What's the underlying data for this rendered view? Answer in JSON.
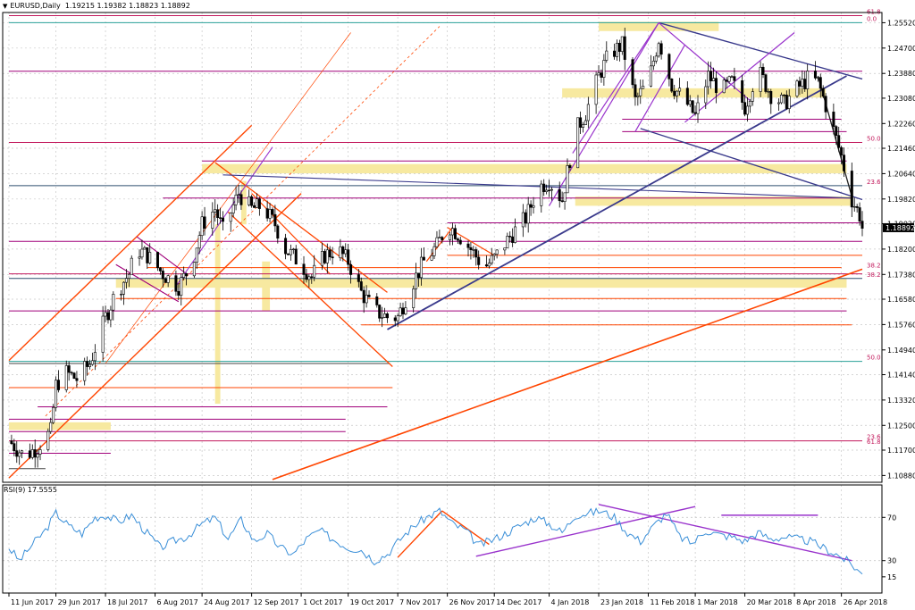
{
  "header": {
    "symbol_title": "EURUSD,Daily",
    "ohlc": "1.19215 1.19382 1.18823 1.18892"
  },
  "rsi": {
    "label": "RSI(9) 17.5555"
  },
  "colors": {
    "fib": "#c2185b",
    "support_orange": "#ff4500",
    "magenta": "#a0007a",
    "purple": "#9933cc",
    "navy": "#3a3a8c",
    "yellow_zone": "#f7e9a0",
    "rsi_line": "#3a8fd8",
    "candle": "#000000"
  },
  "chart_data": [
    {
      "type": "candlestick",
      "title": "EURUSD,Daily",
      "ylim": [
        1.1066,
        1.2585
      ],
      "price_labels": [
        "1.25520",
        "1.24700",
        "1.23880",
        "1.23080",
        "1.22260",
        "1.21460",
        "1.20640",
        "1.19820",
        "1.19020",
        "1.18200",
        "1.17380",
        "1.16580",
        "1.15760",
        "1.14940",
        "1.14140",
        "1.13320",
        "1.12500",
        "1.11700",
        "1.10880"
      ],
      "current_price_label": "1.18892",
      "date_labels": [
        "11 Jun 2017",
        "29 Jun 2017",
        "18 Jul 2017",
        "6 Aug 2017",
        "24 Aug 2017",
        "12 Sep 2017",
        "1 Oct 2017",
        "19 Oct 2017",
        "7 Nov 2017",
        "26 Nov 2017",
        "14 Dec 2017",
        "4 Jan 2018",
        "23 Jan 2018",
        "11 Feb 2018",
        "1 Mar 2018",
        "20 Mar 2018",
        "8 Apr 2018",
        "26 Apr 2018"
      ],
      "fib_labels": [
        {
          "text": "61.8",
          "price": 1.2575
        },
        {
          "text": "0.0",
          "price": 1.2552
        },
        {
          "text": "50.0",
          "price": 1.2165
        },
        {
          "text": "23.6",
          "price": 1.2025
        },
        {
          "text": "38.2",
          "price": 1.1755
        },
        {
          "text": "38.2",
          "price": 1.1725
        },
        {
          "text": "50.0",
          "price": 1.1457
        },
        {
          "text": "23.6",
          "price": 1.12
        },
        {
          "text": "61.8",
          "price": 1.1185
        }
      ],
      "path_anchors": [
        [
          "11 Jun 2017",
          1.12
        ],
        [
          "17 Jun 2017",
          1.115
        ],
        [
          "22 Jun 2017",
          1.118
        ],
        [
          "27 Jun 2017",
          1.123
        ],
        [
          "29 Jun 2017",
          1.138
        ],
        [
          "3 Jul 2017",
          1.142
        ],
        [
          "7 Jul 2017",
          1.14
        ],
        [
          "12 Jul 2017",
          1.145
        ],
        [
          "18 Jul 2017",
          1.16
        ],
        [
          "22 Jul 2017",
          1.168
        ],
        [
          "27 Jul 2017",
          1.174
        ],
        [
          "30 Jul 2017",
          1.182
        ],
        [
          "3 Aug 2017",
          1.18
        ],
        [
          "9 Aug 2017",
          1.174
        ],
        [
          "15 Aug 2017",
          1.17
        ],
        [
          "20 Aug 2017",
          1.177
        ],
        [
          "24 Aug 2017",
          1.19
        ],
        [
          "29 Aug 2017",
          1.195
        ],
        [
          "1 Sep 2017",
          1.188
        ],
        [
          "7 Sep 2017",
          1.2
        ],
        [
          "12 Sep 2017",
          1.195
        ],
        [
          "16 Sep 2017",
          1.196
        ],
        [
          "21 Sep 2017",
          1.19
        ],
        [
          "25 Sep 2017",
          1.182
        ],
        [
          "30 Sep 2017",
          1.178
        ],
        [
          "5 Oct 2017",
          1.173
        ],
        [
          "10 Oct 2017",
          1.18
        ],
        [
          "15 Oct 2017",
          1.182
        ],
        [
          "19 Oct 2017",
          1.178
        ],
        [
          "24 Oct 2017",
          1.168
        ],
        [
          "29 Oct 2017",
          1.162
        ],
        [
          "3 Nov 2017",
          1.16
        ],
        [
          "7 Nov 2017",
          1.16
        ],
        [
          "12 Nov 2017",
          1.17
        ],
        [
          "17 Nov 2017",
          1.178
        ],
        [
          "22 Nov 2017",
          1.183
        ],
        [
          "26 Nov 2017",
          1.19
        ],
        [
          "30 Nov 2017",
          1.187
        ],
        [
          "5 Dec 2017",
          1.182
        ],
        [
          "10 Dec 2017",
          1.176
        ],
        [
          "14 Dec 2017",
          1.179
        ],
        [
          "20 Dec 2017",
          1.186
        ],
        [
          "26 Dec 2017",
          1.192
        ],
        [
          "31 Dec 2017",
          1.202
        ],
        [
          "4 Jan 2018",
          1.204
        ],
        [
          "9 Jan 2018",
          1.198
        ],
        [
          "14 Jan 2018",
          1.22
        ],
        [
          "18 Jan 2018",
          1.226
        ],
        [
          "23 Jan 2018",
          1.238
        ],
        [
          "27 Jan 2018",
          1.245
        ],
        [
          "1 Feb 2018",
          1.248
        ],
        [
          "6 Feb 2018",
          1.23
        ],
        [
          "11 Feb 2018",
          1.236
        ],
        [
          "15 Feb 2018",
          1.25
        ],
        [
          "20 Feb 2018",
          1.235
        ],
        [
          "25 Feb 2018",
          1.23
        ],
        [
          "1 Mar 2018",
          1.225
        ],
        [
          "6 Mar 2018",
          1.238
        ],
        [
          "11 Mar 2018",
          1.233
        ],
        [
          "15 Mar 2018",
          1.236
        ],
        [
          "20 Mar 2018",
          1.228
        ],
        [
          "25 Mar 2018",
          1.24
        ],
        [
          "30 Mar 2018",
          1.232
        ],
        [
          "4 Apr 2018",
          1.229
        ],
        [
          "8 Apr 2018",
          1.233
        ],
        [
          "13 Apr 2018",
          1.237
        ],
        [
          "17 Apr 2018",
          1.236
        ],
        [
          "21 Apr 2018",
          1.226
        ],
        [
          "26 Apr 2018",
          1.212
        ],
        [
          "30 Apr 2018",
          1.198
        ],
        [
          "3 May 2018",
          1.193
        ],
        [
          "4 May 2018",
          1.1889
        ]
      ]
    },
    {
      "type": "line",
      "title": "RSI(9) 17.5555",
      "ylim": [
        0,
        100
      ],
      "y_tick_labels": [
        "70",
        "30",
        "15"
      ],
      "levels": [
        70,
        30
      ],
      "path_anchors": [
        [
          "11 Jun 2017",
          42
        ],
        [
          "15 Jun 2017",
          30
        ],
        [
          "20 Jun 2017",
          45
        ],
        [
          "25 Jun 2017",
          58
        ],
        [
          "29 Jun 2017",
          74
        ],
        [
          "4 Jul 2017",
          62
        ],
        [
          "9 Jul 2017",
          55
        ],
        [
          "14 Jul 2017",
          70
        ],
        [
          "18 Jul 2017",
          72
        ],
        [
          "23 Jul 2017",
          66
        ],
        [
          "28 Jul 2017",
          72
        ],
        [
          "2 Aug 2017",
          58
        ],
        [
          "8 Aug 2017",
          42
        ],
        [
          "13 Aug 2017",
          48
        ],
        [
          "18 Aug 2017",
          52
        ],
        [
          "24 Aug 2017",
          64
        ],
        [
          "29 Aug 2017",
          70
        ],
        [
          "3 Sep 2017",
          50
        ],
        [
          "8 Sep 2017",
          68
        ],
        [
          "13 Sep 2017",
          48
        ],
        [
          "18 Sep 2017",
          55
        ],
        [
          "23 Sep 2017",
          42
        ],
        [
          "28 Sep 2017",
          36
        ],
        [
          "3 Oct 2017",
          50
        ],
        [
          "8 Oct 2017",
          58
        ],
        [
          "13 Oct 2017",
          50
        ],
        [
          "19 Oct 2017",
          42
        ],
        [
          "24 Oct 2017",
          40
        ],
        [
          "29 Oct 2017",
          30
        ],
        [
          "3 Nov 2017",
          36
        ],
        [
          "8 Nov 2017",
          50
        ],
        [
          "13 Nov 2017",
          62
        ],
        [
          "18 Nov 2017",
          70
        ],
        [
          "23 Nov 2017",
          76
        ],
        [
          "28 Nov 2017",
          64
        ],
        [
          "3 Dec 2017",
          58
        ],
        [
          "8 Dec 2017",
          44
        ],
        [
          "14 Dec 2017",
          50
        ],
        [
          "19 Dec 2017",
          56
        ],
        [
          "25 Dec 2017",
          64
        ],
        [
          "30 Dec 2017",
          70
        ],
        [
          "4 Jan 2018",
          64
        ],
        [
          "9 Jan 2018",
          56
        ],
        [
          "14 Jan 2018",
          72
        ],
        [
          "19 Jan 2018",
          74
        ],
        [
          "24 Jan 2018",
          76
        ],
        [
          "29 Jan 2018",
          70
        ],
        [
          "3 Feb 2018",
          56
        ],
        [
          "8 Feb 2018",
          48
        ],
        [
          "13 Feb 2018",
          62
        ],
        [
          "18 Feb 2018",
          74
        ],
        [
          "23 Feb 2018",
          52
        ],
        [
          "28 Feb 2018",
          46
        ],
        [
          "5 Mar 2018",
          58
        ],
        [
          "10 Mar 2018",
          54
        ],
        [
          "15 Mar 2018",
          52
        ],
        [
          "20 Mar 2018",
          48
        ],
        [
          "25 Mar 2018",
          56
        ],
        [
          "30 Mar 2018",
          50
        ],
        [
          "4 Apr 2018",
          52
        ],
        [
          "9 Apr 2018",
          50
        ],
        [
          "14 Apr 2018",
          48
        ],
        [
          "19 Apr 2018",
          42
        ],
        [
          "24 Apr 2018",
          36
        ],
        [
          "28 Apr 2018",
          30
        ],
        [
          "2 May 2018",
          22
        ],
        [
          "4 May 2018",
          17.56
        ]
      ]
    }
  ]
}
